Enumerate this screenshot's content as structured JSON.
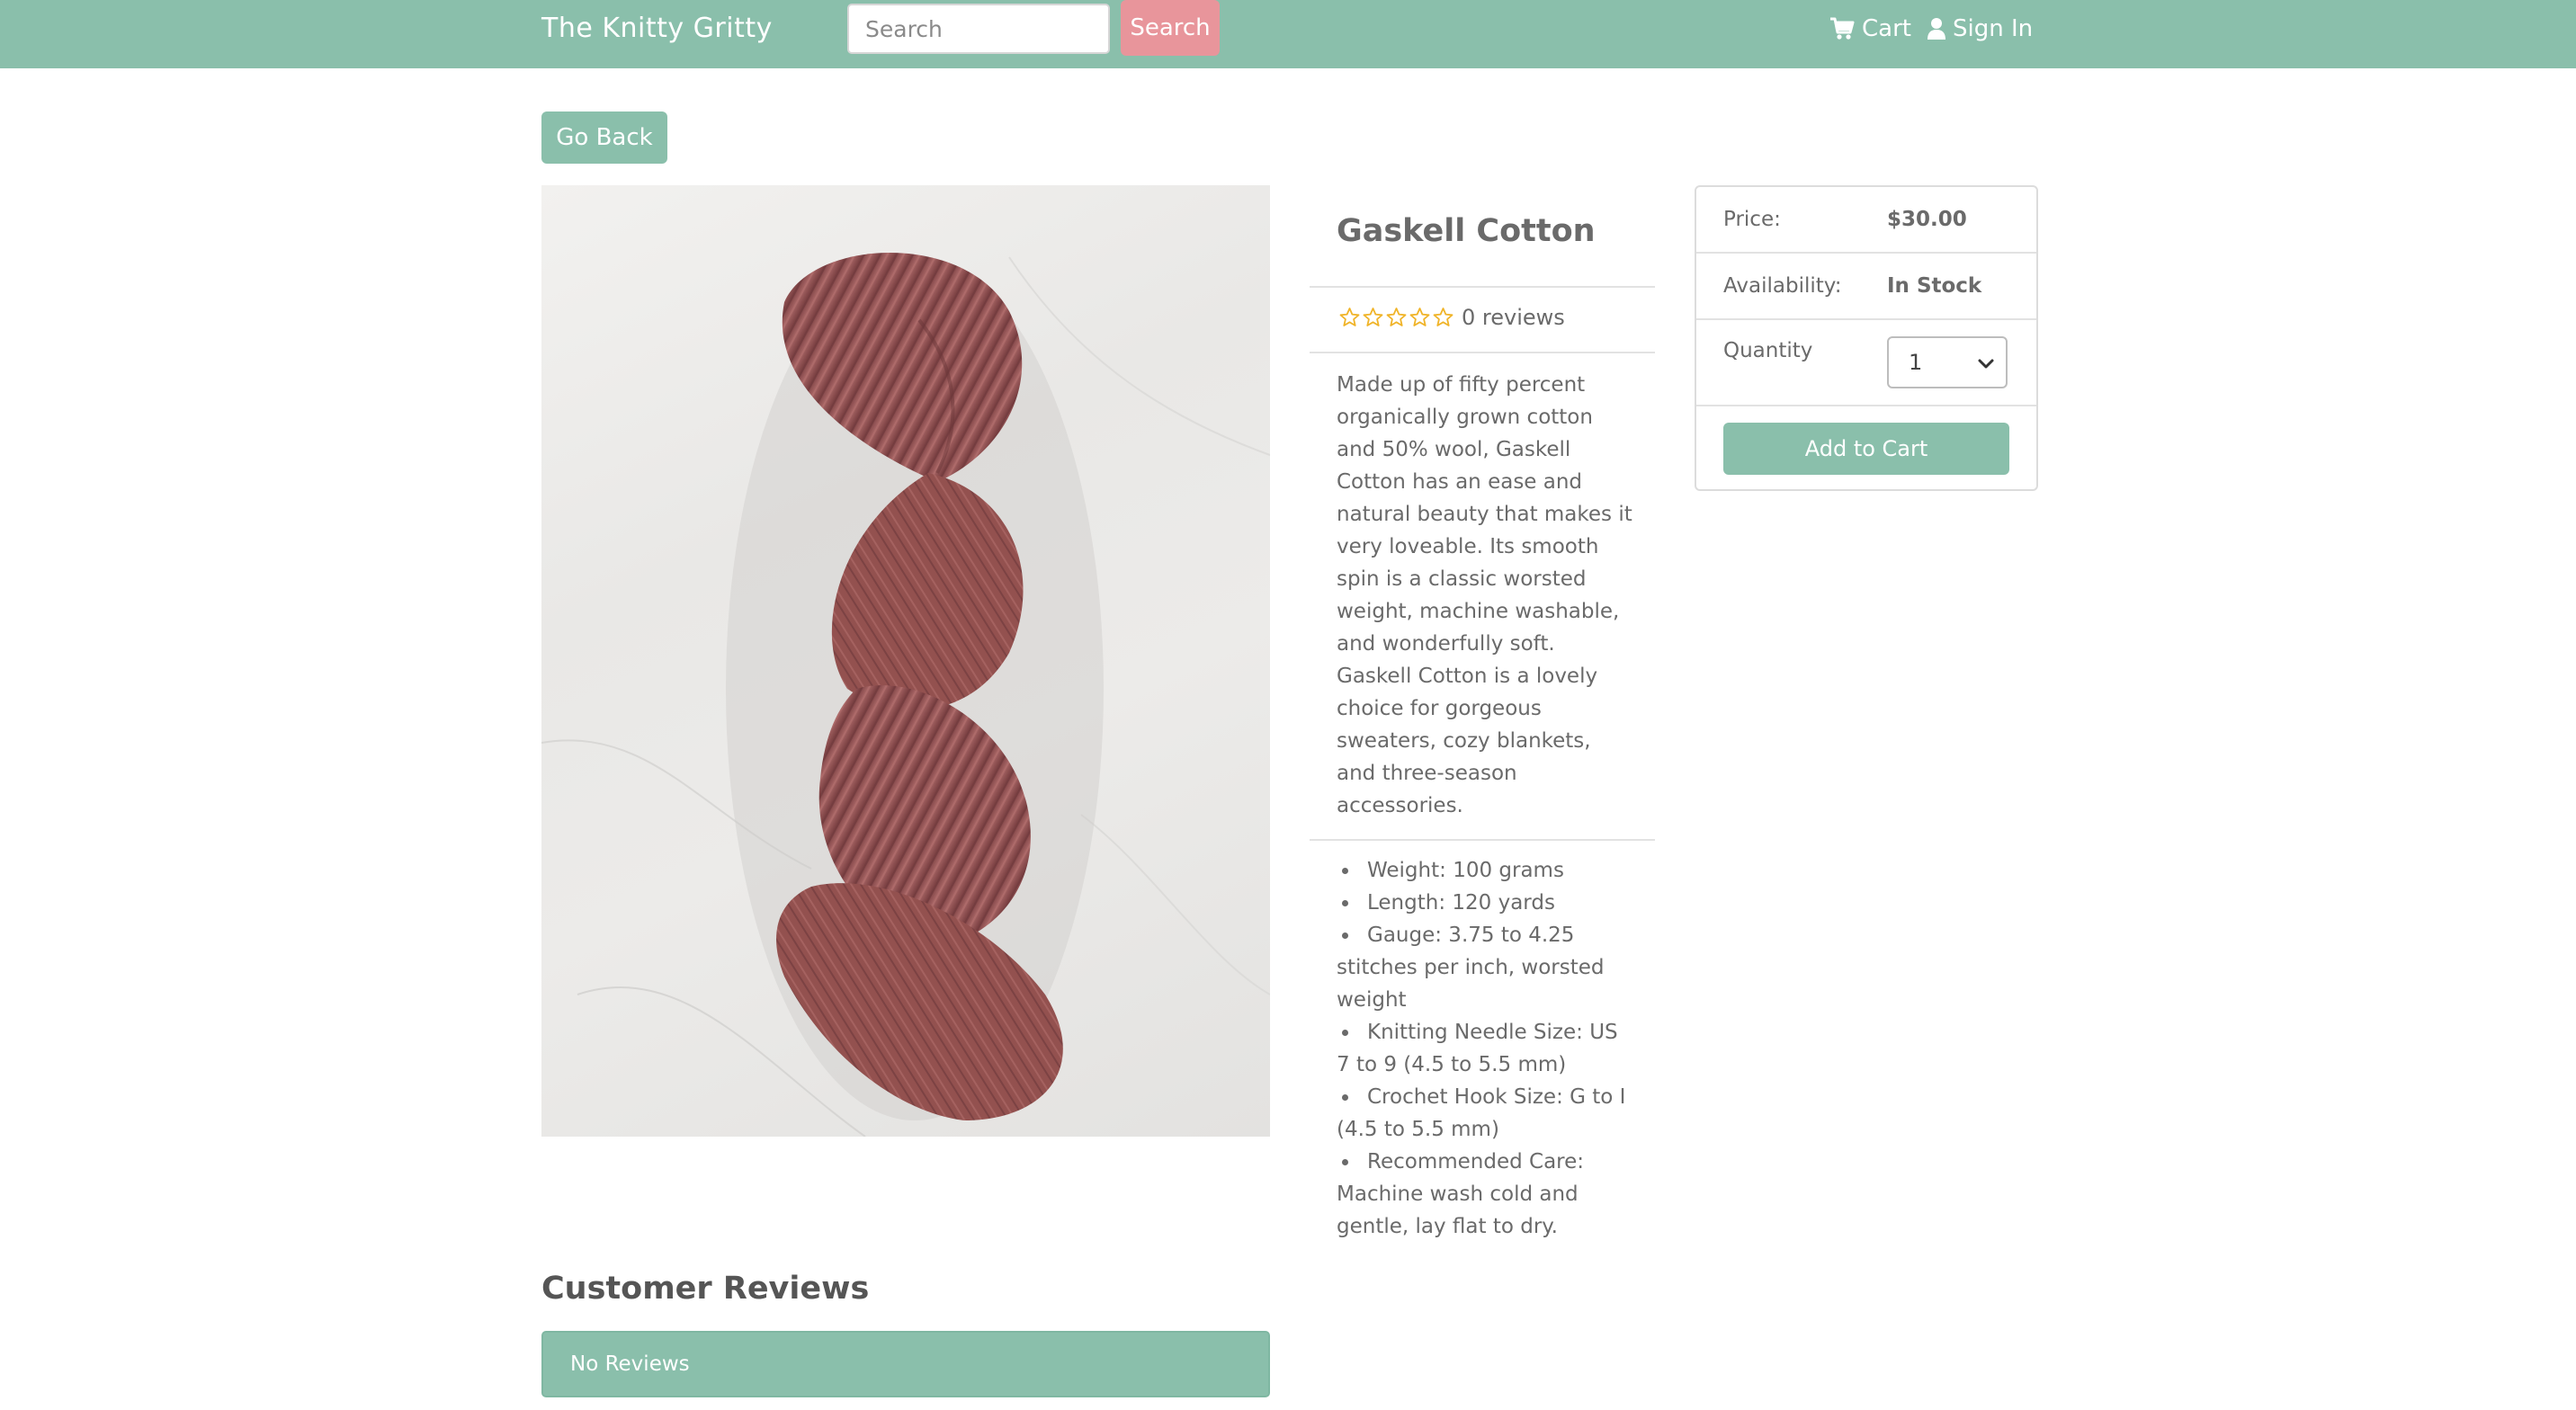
{
  "navbar": {
    "brand": "The Knitty Gritty",
    "search_placeholder": "Search",
    "search_button": "Search",
    "cart_label": "Cart",
    "signin_label": "Sign In"
  },
  "go_back_label": "Go Back",
  "product": {
    "title": "Gaskell Cotton",
    "rating": 0,
    "review_count_label": "0 reviews",
    "description": "Made up of fifty percent organically grown cotton and 50% wool, Gaskell Cotton has an ease and natural beauty that makes it very loveable. Its smooth spin is a classic worsted weight, machine washable, and wonderfully soft. Gaskell Cotton is a lovely choice for gorgeous sweaters, cozy blankets, and three-season accessories.",
    "specs": [
      "Weight: 100 grams",
      "Length: 120 yards",
      "Gauge: 3.75 to 4.25 stitches per inch, worsted weight",
      "Knitting Needle Size: US 7 to 9 (4.5 to 5.5 mm)",
      "Crochet Hook Size: G to I (4.5 to 5.5 mm)",
      "Recommended Care: Machine wash cold and gentle, lay flat to dry."
    ]
  },
  "cart_card": {
    "price_label": "Price:",
    "price_value": "$30.00",
    "availability_label": "Availability:",
    "availability_value": "In Stock",
    "quantity_label": "Quantity",
    "quantity_value": "1",
    "add_button": "Add to Cart"
  },
  "reviews": {
    "heading": "Customer Reviews",
    "empty_message": "No Reviews"
  },
  "colors": {
    "primary": "#8abfab",
    "search_button": "#e8959b",
    "star": "#f0b429",
    "yarn": "#9c5a5a"
  },
  "icons": {
    "cart": "shopping-cart-icon",
    "user": "user-icon",
    "star": "star-outline-icon",
    "select": "chevron-down-icon"
  }
}
